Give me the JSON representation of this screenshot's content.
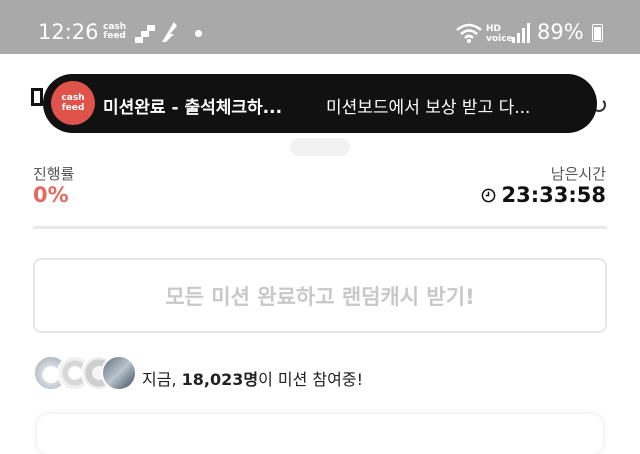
{
  "status_bar": {
    "time": "12:26",
    "cashfeed_line1": "cash",
    "cashfeed_line2": "feed",
    "hd_line1": "HD",
    "hd_line2": "voice",
    "battery": "89%"
  },
  "toast": {
    "logo_line1": "cash",
    "logo_line2": "feed",
    "title": "미션완료 - 출석체크하...",
    "message": "미션보드에서 보상 받고 다..."
  },
  "progress": {
    "label": "진행률",
    "value": "0%"
  },
  "remaining": {
    "label": "남은시간",
    "value": "23:33:58"
  },
  "reward_button": {
    "label": "모든 미션 완료하고 랜덤캐시 받기!"
  },
  "participants": {
    "prefix": "지금, ",
    "count": "18,023명",
    "suffix": "이 미션 참여중!"
  },
  "colors": {
    "accent": "#e36a5f",
    "toast_bg": "#111111",
    "status_bar_bg": "#a9a9a9"
  }
}
